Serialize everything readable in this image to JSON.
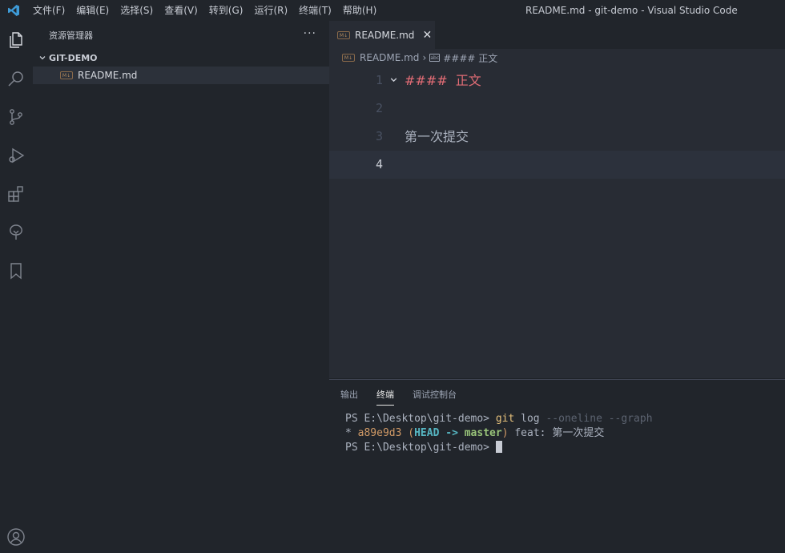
{
  "titlebar": {
    "menu": [
      "文件(F)",
      "编辑(E)",
      "选择(S)",
      "查看(V)",
      "转到(G)",
      "运行(R)",
      "终端(T)",
      "帮助(H)"
    ],
    "window_title": "README.md - git-demo - Visual Studio Code"
  },
  "activity_bar": {
    "icons": [
      "explorer-icon",
      "search-icon",
      "source-control-icon",
      "run-debug-icon",
      "extensions-icon",
      "remote-tree-icon",
      "bookmark-icon",
      "account-icon"
    ]
  },
  "sidebar": {
    "title": "资源管理器",
    "more": "···",
    "folder": "GIT-DEMO",
    "files": [
      {
        "badge": "M↓",
        "name": "README.md"
      }
    ]
  },
  "editor": {
    "tab": {
      "badge": "M↓",
      "label": "README.md",
      "close": "✕"
    },
    "breadcrumb": {
      "file_badge": "M↓",
      "file": "README.md",
      "sep": "›",
      "symbol_badge": "abc",
      "symbol": "#### 正文"
    },
    "lines": [
      {
        "num": "1",
        "text": "####  正文"
      },
      {
        "num": "2",
        "text": ""
      },
      {
        "num": "3",
        "text": "第一次提交"
      },
      {
        "num": "4",
        "text": ""
      }
    ]
  },
  "panel": {
    "tabs": [
      "输出",
      "终端",
      "调试控制台"
    ],
    "active_tab": "终端",
    "terminal": {
      "line1": {
        "prompt": "PS E:\\Desktop\\git-demo> ",
        "cmd": "git",
        "args": " log ",
        "flags": "--oneline --graph"
      },
      "line2": {
        "star": "* ",
        "hash": "a89e9d3",
        "open": " (",
        "head": "HEAD -> ",
        "branch": "master",
        "close": ")",
        "msg": " feat: 第一次提交"
      },
      "line3": {
        "prompt": "PS E:\\Desktop\\git-demo> "
      }
    }
  },
  "colors": {
    "accent": "#528bff",
    "heading": "#e06c75",
    "branch": "#98c379",
    "head": "#56b6c2",
    "hash": "#d19a66"
  }
}
